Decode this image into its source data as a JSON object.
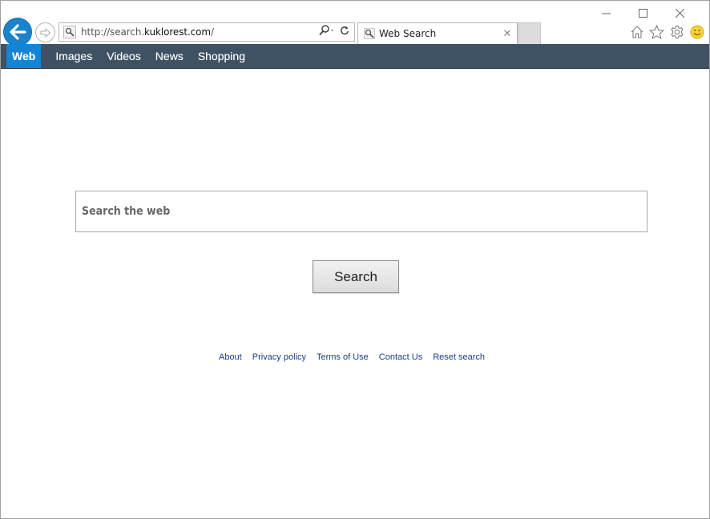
{
  "browser": {
    "window_controls": {
      "minimize": "—",
      "maximize": "☐",
      "close": "✕"
    },
    "address_bar": {
      "url_prefix": "http://search.",
      "url_domain": "kuklorest.com",
      "url_suffix": "/",
      "search_icon": "search-icon",
      "tools": [
        "search-dropdown-icon",
        "refresh-icon"
      ]
    },
    "tab": {
      "title": "Web Search",
      "close_label": "✕"
    },
    "toolbar_icons": [
      "home-icon",
      "star-icon",
      "gear-icon",
      "smiley-icon"
    ]
  },
  "navbar": {
    "items": [
      {
        "label": "Web",
        "active": true
      },
      {
        "label": "Images",
        "active": false
      },
      {
        "label": "Videos",
        "active": false
      },
      {
        "label": "News",
        "active": false
      },
      {
        "label": "Shopping",
        "active": false
      }
    ],
    "background": "#3f5263",
    "active_color": "#1384d6"
  },
  "search": {
    "placeholder": "Search the web",
    "value": "",
    "button_label": "Search"
  },
  "footer": {
    "links": [
      "About",
      "Privacy policy",
      "Terms of Use",
      "Contact Us",
      "Reset search"
    ],
    "link_color": "#1b3d8a"
  }
}
